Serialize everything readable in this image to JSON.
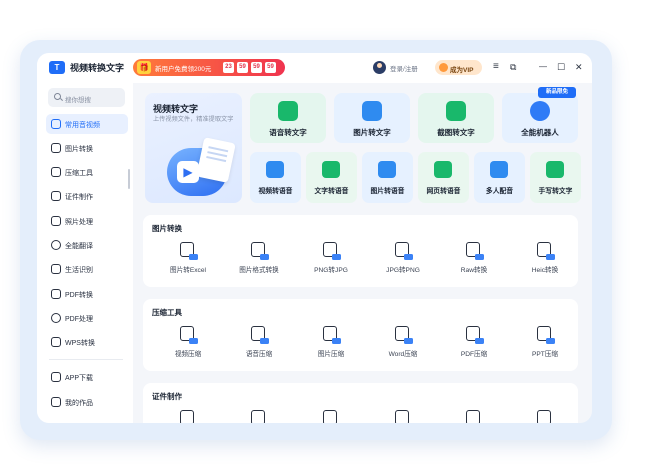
{
  "app": {
    "title": "视频转换文字",
    "logo_text": "T"
  },
  "promo": {
    "text": "新用户免费领200元",
    "timer": [
      "23",
      "59",
      "59",
      "59"
    ]
  },
  "user": {
    "login_label": "登录/注册",
    "vip_label": "成为VIP"
  },
  "window_controls": {
    "menu": "≡",
    "pin": "⧉",
    "minimize": "—",
    "maximize": "☐",
    "close": "✕"
  },
  "search": {
    "placeholder": "搜你想搜"
  },
  "sidebar": {
    "items": [
      {
        "label": "常用音视频",
        "active": true
      },
      {
        "label": "图片转换"
      },
      {
        "label": "压缩工具"
      },
      {
        "label": "证件制作"
      },
      {
        "label": "照片处理"
      },
      {
        "label": "全能翻译"
      },
      {
        "label": "生活识别"
      },
      {
        "label": "PDF转换"
      },
      {
        "label": "PDF处理"
      },
      {
        "label": "WPS转换"
      }
    ],
    "bottom": [
      {
        "label": "APP下载"
      },
      {
        "label": "我的作品"
      }
    ]
  },
  "hero": {
    "title": "视频转文字",
    "subtitle": "上传视频文件，精准提取文字"
  },
  "featured": [
    {
      "label": "语音转文字",
      "icon": "microphone-icon",
      "color": "#19b86b"
    },
    {
      "label": "图片转文字",
      "icon": "image-text-icon",
      "color": "#2f8bf0"
    },
    {
      "label": "截图转文字",
      "icon": "screenshot-icon",
      "color": "#19b86b"
    },
    {
      "label": "全能机器人",
      "icon": "robot-icon",
      "color": "#2f7bf6"
    }
  ],
  "featured_badge": "新品限免",
  "quick_tools": [
    {
      "label": "视频转语音",
      "color": "#2f8bf0"
    },
    {
      "label": "文字转语音",
      "color": "#19b86b"
    },
    {
      "label": "图片转语音",
      "color": "#2f8bf0"
    },
    {
      "label": "网页转语音",
      "color": "#19b86b"
    },
    {
      "label": "多人配音",
      "color": "#2f8bf0"
    },
    {
      "label": "手写转文字",
      "color": "#19b86b"
    }
  ],
  "sections": [
    {
      "title": "图片转换",
      "tools": [
        "图片转Excel",
        "图片格式转换",
        "PNG转JPG",
        "JPG转PNG",
        "Raw转换",
        "Heic转换"
      ]
    },
    {
      "title": "压缩工具",
      "tools": [
        "视频压缩",
        "语音压缩",
        "图片压缩",
        "Word压缩",
        "PDF压缩",
        "PPT压缩"
      ]
    },
    {
      "title": "证件制作",
      "tools": [
        "",
        "",
        "",
        "",
        "",
        ""
      ]
    }
  ]
}
